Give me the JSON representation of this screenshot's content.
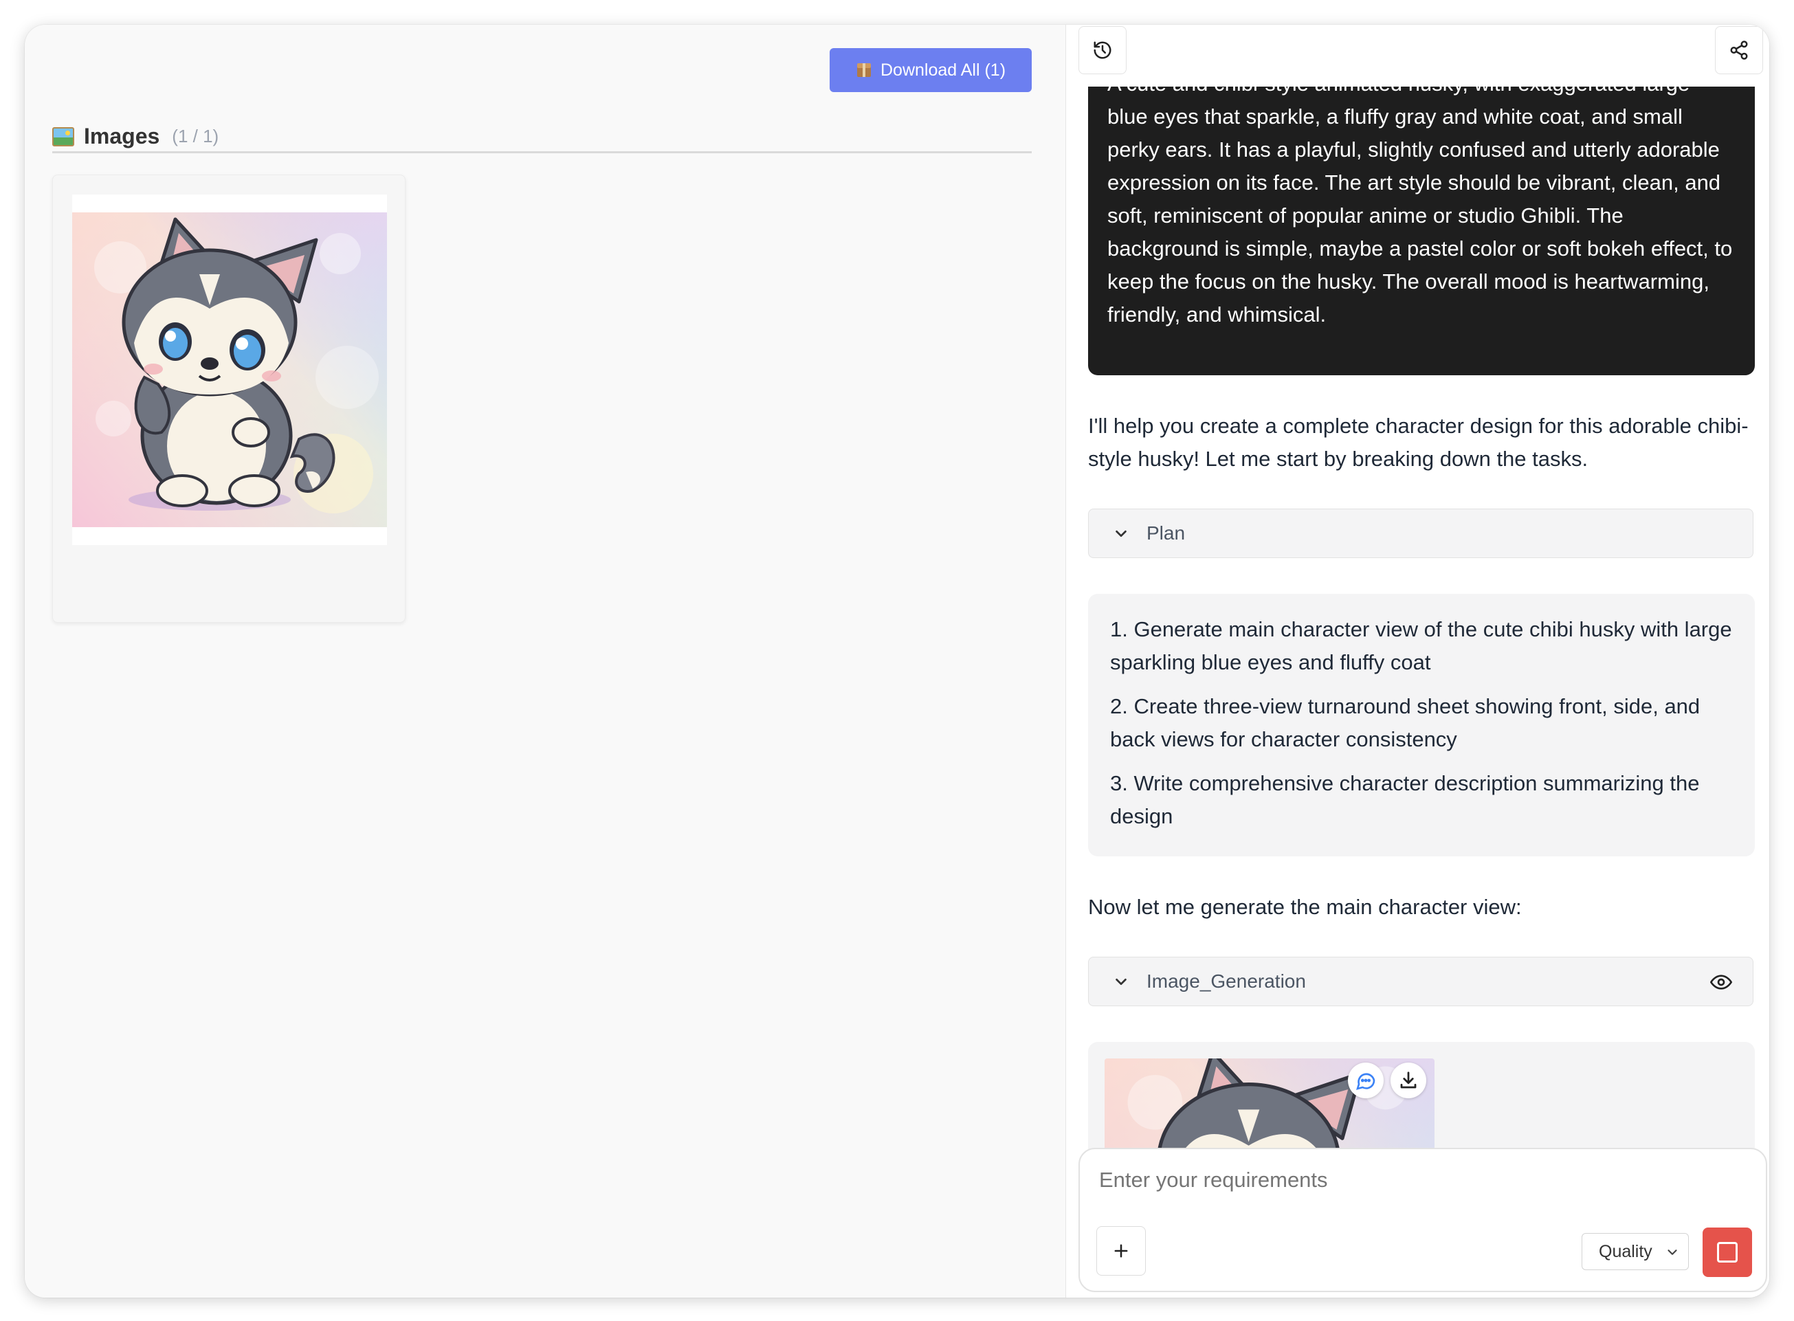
{
  "left_panel": {
    "download_all_label": "Download All (1)",
    "images_title": "Images",
    "images_count": "(1 / 1)"
  },
  "conversation": {
    "prompt_text": "A cute and chibi-style animated husky, with exaggerated large blue eyes that sparkle, a fluffy gray and white coat, and small perky ears. It has a playful, slightly confused and utterly adorable expression on its face. The art style should be vibrant, clean, and soft, reminiscent of popular anime or studio Ghibli. The background is simple, maybe a pastel color or soft bokeh effect, to keep the focus on the husky. The overall mood is heartwarming, friendly, and whimsical.",
    "assistant_intro": "I'll help you create a complete character design for this adorable chibi-style husky! Let me start by breaking down the tasks.",
    "plan_label": "Plan",
    "plan_steps": [
      "1. Generate main character view of the cute chibi husky with large sparkling blue eyes and fluffy coat",
      "2. Create three-view turnaround sheet showing front, side, and back views for character consistency",
      "3. Write comprehensive character description summarizing the design"
    ],
    "assistant_followup": "Now let me generate the main character view:",
    "tool_label": "Image_Generation"
  },
  "input": {
    "placeholder": "Enter your requirements",
    "quality_label": "Quality"
  },
  "icons": {
    "history": "history-icon",
    "share": "share-icon",
    "chevron": "chevron-down-icon",
    "eye": "eye-icon",
    "comment": "comment-icon",
    "download": "download-icon",
    "plus": "plus-icon",
    "stop": "stop-icon"
  },
  "colors": {
    "download_button": "#6c7ff0",
    "stop_button": "#e5534b",
    "prompt_bubble": "#1e1e1e"
  }
}
